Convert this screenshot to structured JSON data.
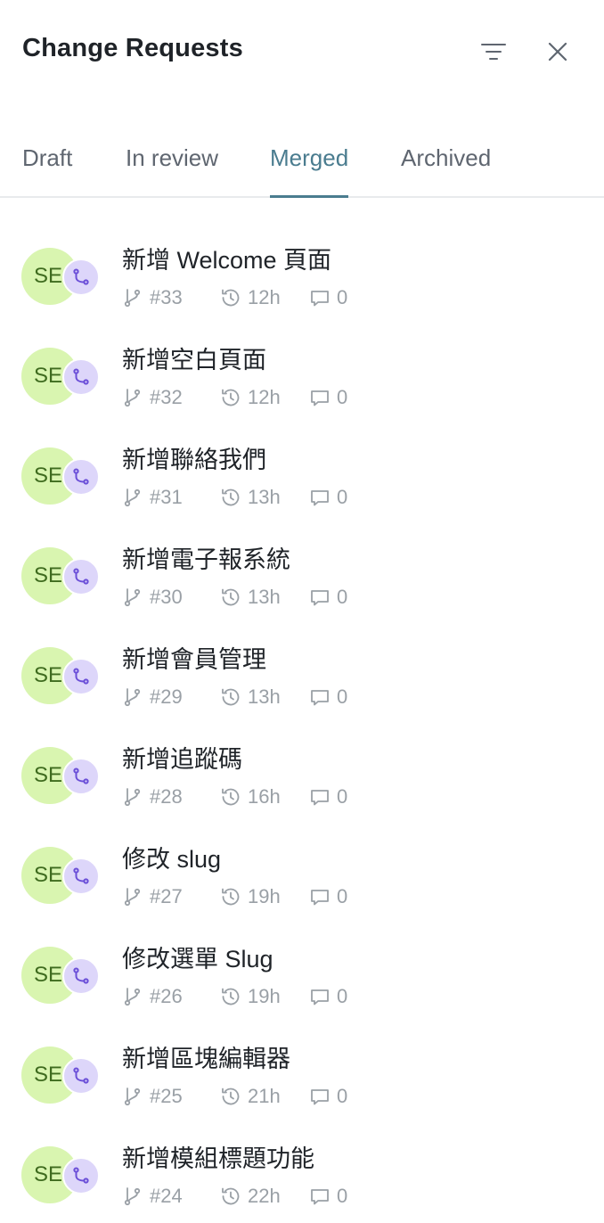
{
  "header": {
    "title": "Change Requests"
  },
  "tabs": [
    {
      "label": "Draft",
      "active": false
    },
    {
      "label": "In review",
      "active": false
    },
    {
      "label": "Merged",
      "active": true
    },
    {
      "label": "Archived",
      "active": false
    }
  ],
  "colors": {
    "accent": "#4a7c8f",
    "avatar_bg": "#d9f5b0",
    "avatar_text": "#3f6b1f",
    "badge_bg": "#ddd6fa",
    "badge_icon": "#6b4fd8",
    "meta": "#9aa0a6"
  },
  "icons": {
    "filter": "filter-icon",
    "close": "close-icon",
    "branch": "git-branch-icon",
    "history": "history-icon",
    "comment": "comment-icon",
    "merge": "git-merge-icon"
  },
  "items": [
    {
      "avatar": "SE",
      "title": "新增 Welcome 頁面",
      "number": "#33",
      "time": "12h",
      "comments": "0"
    },
    {
      "avatar": "SE",
      "title": "新增空白頁面",
      "number": "#32",
      "time": "12h",
      "comments": "0"
    },
    {
      "avatar": "SE",
      "title": "新增聯絡我們",
      "number": "#31",
      "time": "13h",
      "comments": "0"
    },
    {
      "avatar": "SE",
      "title": "新增電子報系統",
      "number": "#30",
      "time": "13h",
      "comments": "0"
    },
    {
      "avatar": "SE",
      "title": "新增會員管理",
      "number": "#29",
      "time": "13h",
      "comments": "0"
    },
    {
      "avatar": "SE",
      "title": "新增追蹤碼",
      "number": "#28",
      "time": "16h",
      "comments": "0"
    },
    {
      "avatar": "SE",
      "title": "修改 slug",
      "number": "#27",
      "time": "19h",
      "comments": "0"
    },
    {
      "avatar": "SE",
      "title": "修改選單 Slug",
      "number": "#26",
      "time": "19h",
      "comments": "0"
    },
    {
      "avatar": "SE",
      "title": "新增區塊編輯器",
      "number": "#25",
      "time": "21h",
      "comments": "0"
    },
    {
      "avatar": "SE",
      "title": "新增模組標題功能",
      "number": "#24",
      "time": "22h",
      "comments": "0"
    }
  ]
}
